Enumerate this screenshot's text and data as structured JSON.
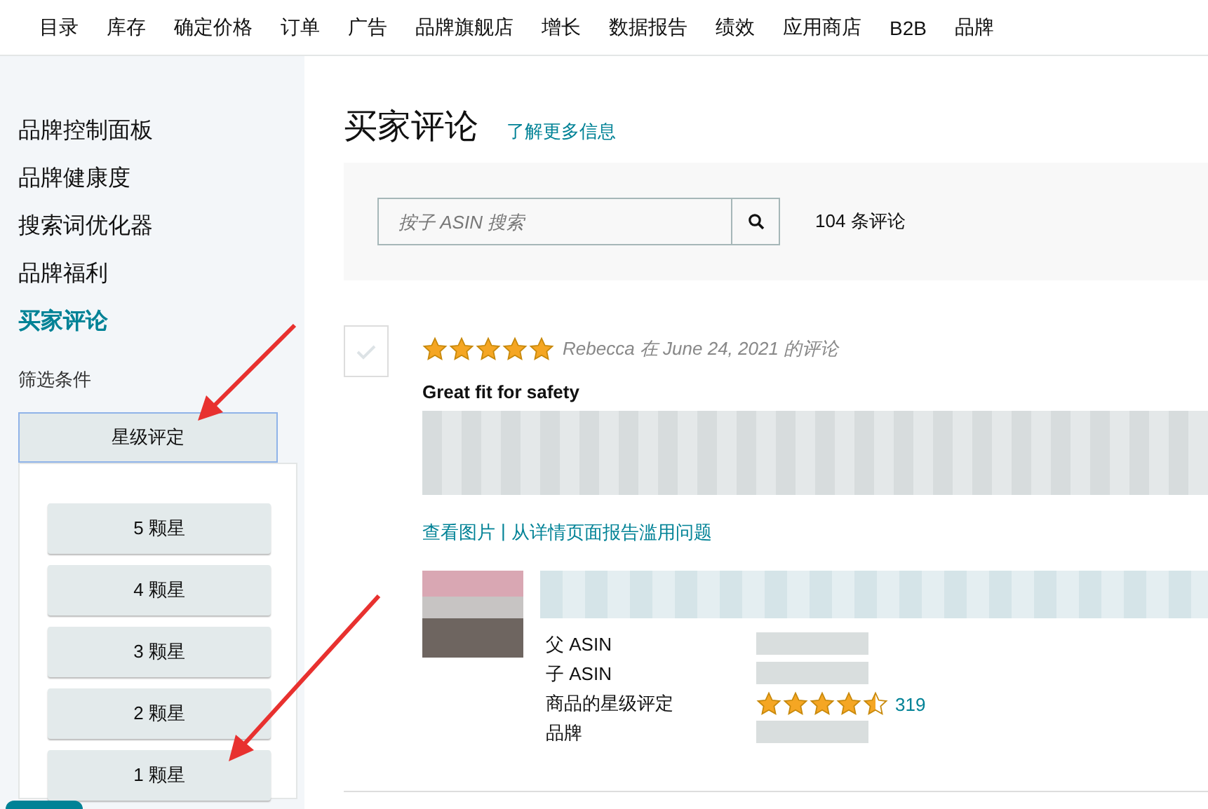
{
  "top_nav": {
    "items": [
      {
        "label": "目录",
        "selected": false
      },
      {
        "label": "库存",
        "selected": false
      },
      {
        "label": "确定价格",
        "selected": false
      },
      {
        "label": "订单",
        "selected": false
      },
      {
        "label": "广告",
        "selected": false
      },
      {
        "label": "品牌旗舰店",
        "selected": false
      },
      {
        "label": "增长",
        "selected": false
      },
      {
        "label": "数据报告",
        "selected": false
      },
      {
        "label": "绩效",
        "selected": false
      },
      {
        "label": "应用商店",
        "selected": false
      },
      {
        "label": "B2B",
        "selected": false
      },
      {
        "label": "品牌",
        "selected": false
      }
    ]
  },
  "sidebar": {
    "items": [
      {
        "label": "品牌控制面板",
        "selected": false
      },
      {
        "label": "品牌健康度",
        "selected": false
      },
      {
        "label": "搜索词优化器",
        "selected": false
      },
      {
        "label": "品牌福利",
        "selected": false
      },
      {
        "label": "买家评论",
        "selected": true
      }
    ],
    "filter_label": "筛选条件",
    "filter_dropdown": {
      "label": "星级评定",
      "expanded": true,
      "options": [
        "5 颗星",
        "4 颗星",
        "3 颗星",
        "2 颗星",
        "1 颗星"
      ]
    }
  },
  "page": {
    "title": "买家评论",
    "learn_more_link": "了解更多信息"
  },
  "search": {
    "placeholder": "按子 ASIN 搜索",
    "count": "104 条评论"
  },
  "review": {
    "checked": false,
    "stars": 5,
    "byline": "Rebecca 在 June 24, 2021 的评论",
    "title": "Great fit for safety",
    "links": [
      "查看图片",
      "从详情页面报告滥用问题"
    ],
    "link_separator": "|",
    "product": {
      "fields": [
        {
          "label": "父 ASIN",
          "kind": "blurred"
        },
        {
          "label": "子 ASIN",
          "kind": "blurred"
        },
        {
          "label": "商品的星级评定",
          "kind": "rating",
          "stars": 4.5,
          "count": "319"
        },
        {
          "label": "品牌",
          "kind": "blurred"
        }
      ]
    }
  }
}
